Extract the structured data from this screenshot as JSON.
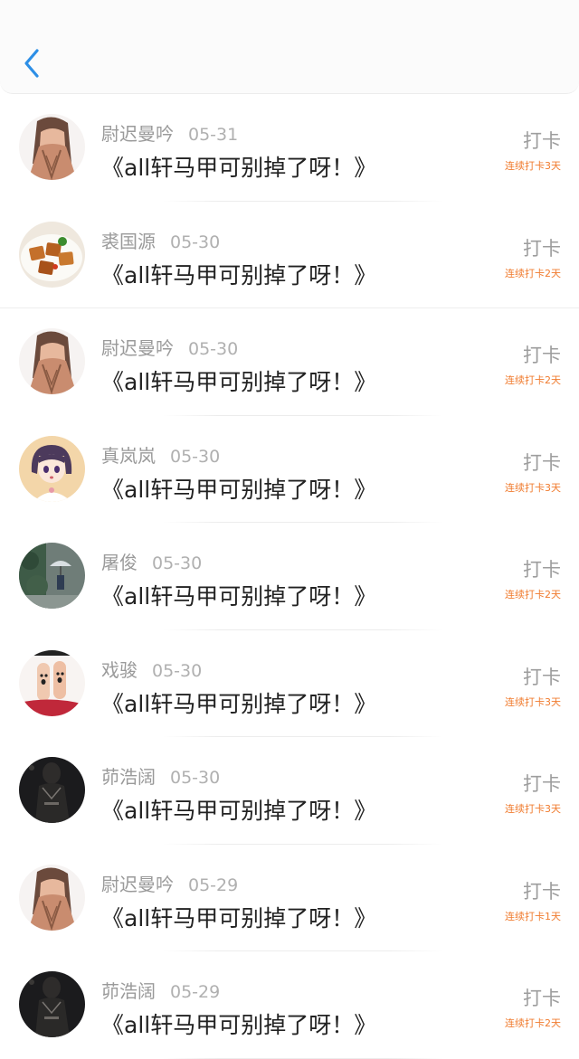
{
  "header": {
    "back_icon": "chevron-left-icon",
    "accent_color": "#2d8fe6"
  },
  "colors": {
    "streak": "#f07b2e",
    "name": "#9a9a9a",
    "title": "#222222"
  },
  "entries": [
    {
      "name": "尉迟曼吟",
      "date": "05-31",
      "title": "《all轩马甲可别掉了呀！》",
      "action": "打卡",
      "streak": "连续打卡3天",
      "avatar": "girl-hiding-face-avatar"
    },
    {
      "name": "裘国源",
      "date": "05-30",
      "title": "《all轩马甲可别掉了呀！》",
      "action": "打卡",
      "streak": "连续打卡2天",
      "avatar": "food-dish-avatar"
    },
    {
      "name": "尉迟曼吟",
      "date": "05-30",
      "title": "《all轩马甲可别掉了呀！》",
      "action": "打卡",
      "streak": "连续打卡2天",
      "avatar": "girl-hiding-face-avatar"
    },
    {
      "name": "真岚岚",
      "date": "05-30",
      "title": "《all轩马甲可别掉了呀！》",
      "action": "打卡",
      "streak": "连续打卡3天",
      "avatar": "anime-girl-avatar"
    },
    {
      "name": "屠俊",
      "date": "05-30",
      "title": "《all轩马甲可别掉了呀！》",
      "action": "打卡",
      "streak": "连续打卡2天",
      "avatar": "umbrella-scene-avatar"
    },
    {
      "name": "戏骏",
      "date": "05-30",
      "title": "《all轩马甲可别掉了呀！》",
      "action": "打卡",
      "streak": "连续打卡3天",
      "avatar": "finger-faces-avatar"
    },
    {
      "name": "茆浩阔",
      "date": "05-30",
      "title": "《all轩马甲可别掉了呀！》",
      "action": "打卡",
      "streak": "连续打卡3天",
      "avatar": "dark-figure-avatar"
    },
    {
      "name": "尉迟曼吟",
      "date": "05-29",
      "title": "《all轩马甲可别掉了呀！》",
      "action": "打卡",
      "streak": "连续打卡1天",
      "avatar": "girl-hiding-face-avatar"
    },
    {
      "name": "茆浩阔",
      "date": "05-29",
      "title": "《all轩马甲可别掉了呀！》",
      "action": "打卡",
      "streak": "连续打卡2天",
      "avatar": "dark-figure-avatar"
    }
  ]
}
